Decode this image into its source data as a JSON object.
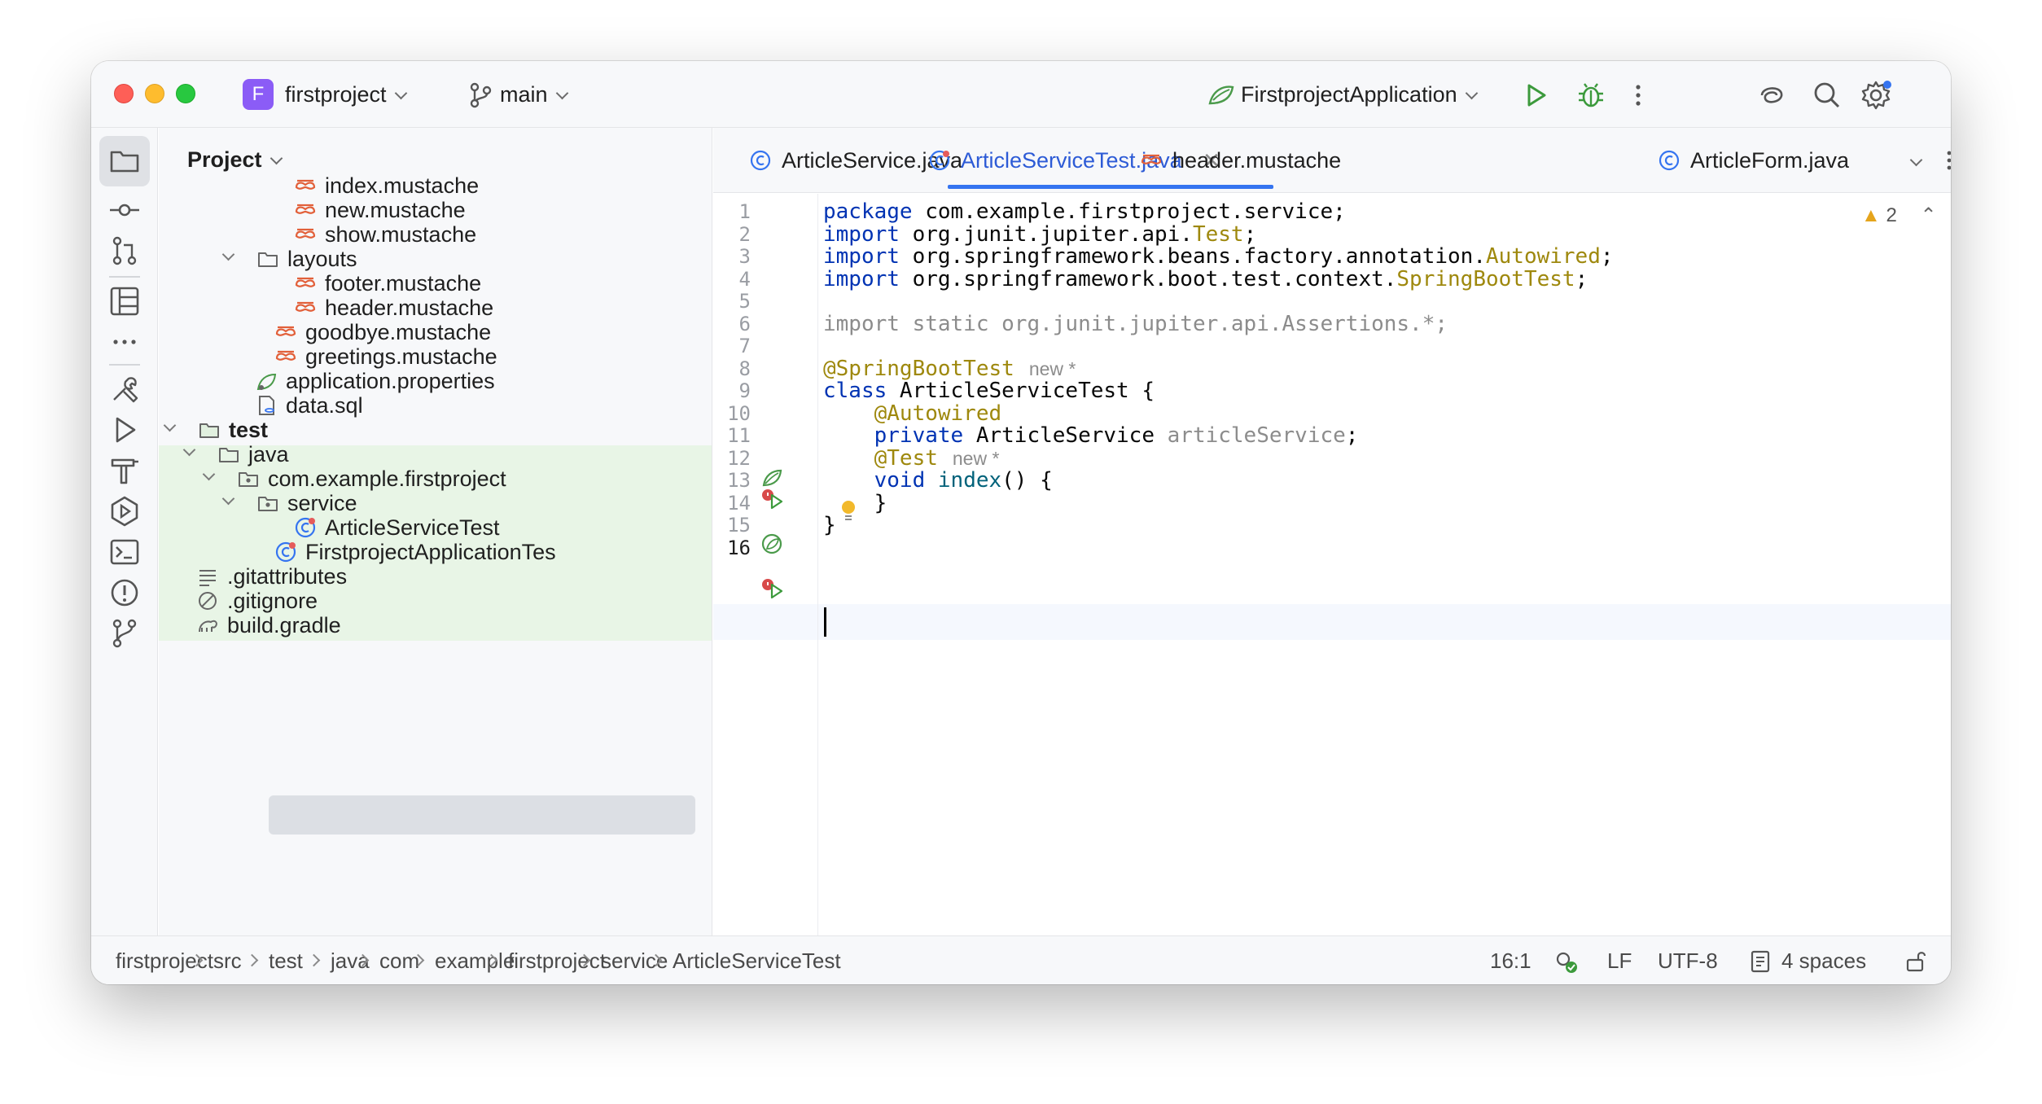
{
  "titlebar": {
    "project_badge": "F",
    "project_name": "firstproject",
    "branch": "main",
    "run_config": "FirstprojectApplication"
  },
  "project_panel": {
    "title": "Project",
    "tree": [
      {
        "label": "index.mustache",
        "icon": "mustache-file-icon"
      },
      {
        "label": "new.mustache",
        "icon": "mustache-file-icon"
      },
      {
        "label": "show.mustache",
        "icon": "mustache-file-icon"
      },
      {
        "label": "layouts",
        "icon": "folder-icon",
        "expanded": true
      },
      {
        "label": "footer.mustache",
        "icon": "mustache-file-icon"
      },
      {
        "label": "header.mustache",
        "icon": "mustache-file-icon"
      },
      {
        "label": "goodbye.mustache",
        "icon": "mustache-file-icon"
      },
      {
        "label": "greetings.mustache",
        "icon": "mustache-file-icon"
      },
      {
        "label": "application.properties",
        "icon": "properties-file-icon"
      },
      {
        "label": "data.sql",
        "icon": "sql-file-icon"
      },
      {
        "label": "test",
        "icon": "test-folder-icon",
        "expanded": true
      },
      {
        "label": "java",
        "icon": "folder-icon",
        "expanded": true
      },
      {
        "label": "com.example.firstproject",
        "icon": "package-icon",
        "expanded": true
      },
      {
        "label": "service",
        "icon": "package-icon",
        "expanded": true
      },
      {
        "label": "ArticleServiceTest",
        "icon": "test-class-icon",
        "selected": true
      },
      {
        "label": "FirstprojectApplicationTes",
        "icon": "test-class-icon"
      },
      {
        "label": ".gitattributes",
        "icon": "text-file-icon"
      },
      {
        "label": ".gitignore",
        "icon": "ignore-file-icon"
      },
      {
        "label": "build.gradle",
        "icon": "gradle-icon"
      }
    ]
  },
  "tabs": [
    {
      "label": "ArticleService.java",
      "icon": "class-icon"
    },
    {
      "label": "ArticleServiceTest.java",
      "icon": "test-class-icon",
      "active": true
    },
    {
      "label": "header.mustache",
      "icon": "mustache-file-icon"
    },
    {
      "label": "ArticleForm.java",
      "icon": "class-icon"
    }
  ],
  "editor": {
    "warning_count": "2",
    "line_numbers": [
      "1",
      "2",
      "3",
      "4",
      "5",
      "6",
      "7",
      "8",
      "9",
      "10",
      "11",
      "12",
      "13",
      "14",
      "15",
      "16"
    ],
    "lines": {
      "l1_kw": "package",
      "l1_rest": " com.example.firstproject.service;",
      "l2_kw": "import",
      "l2_rest": " org.junit.jupiter.api.",
      "l2_cls": "Test",
      "l2_end": ";",
      "l3_kw": "import",
      "l3_rest": " org.springframework.beans.factory.annotation.",
      "l3_cls": "Autowired",
      "l3_end": ";",
      "l4_kw": "import",
      "l4_rest": " org.springframework.boot.test.context.",
      "l4_cls": "SpringBootTest",
      "l4_end": ";",
      "l6": "import static org.junit.jupiter.api.Assertions.*;",
      "l8_ann": "@SpringBootTest",
      "l8_hint": "new *",
      "l9_kw": "class",
      "l9_rest": " ArticleServiceTest {",
      "l10_ann": "    @Autowired",
      "l11_kw": "    private",
      "l11_type": " ArticleService ",
      "l11_field": "articleService",
      "l11_end": ";",
      "l12_ann": "    @Test",
      "l12_hint": "new *",
      "l13_kw": "    void",
      "l13_fn": " index",
      "l13_end": "() {",
      "l14": "    }",
      "l15": "}"
    }
  },
  "statusbar": {
    "breadcrumbs": [
      "firstproject",
      "src",
      "test",
      "java",
      "com",
      "example",
      "firstproject",
      "service",
      "ArticleServiceTest"
    ],
    "position": "16:1",
    "line_separator": "LF",
    "encoding": "UTF-8",
    "indent": "4 spaces"
  },
  "colors": {
    "accent": "#3574f0",
    "keyword": "#0033b3",
    "annotation": "#9e880d",
    "mustache_icon": "#e2603a",
    "test_highlight": "#e8f5e6"
  }
}
